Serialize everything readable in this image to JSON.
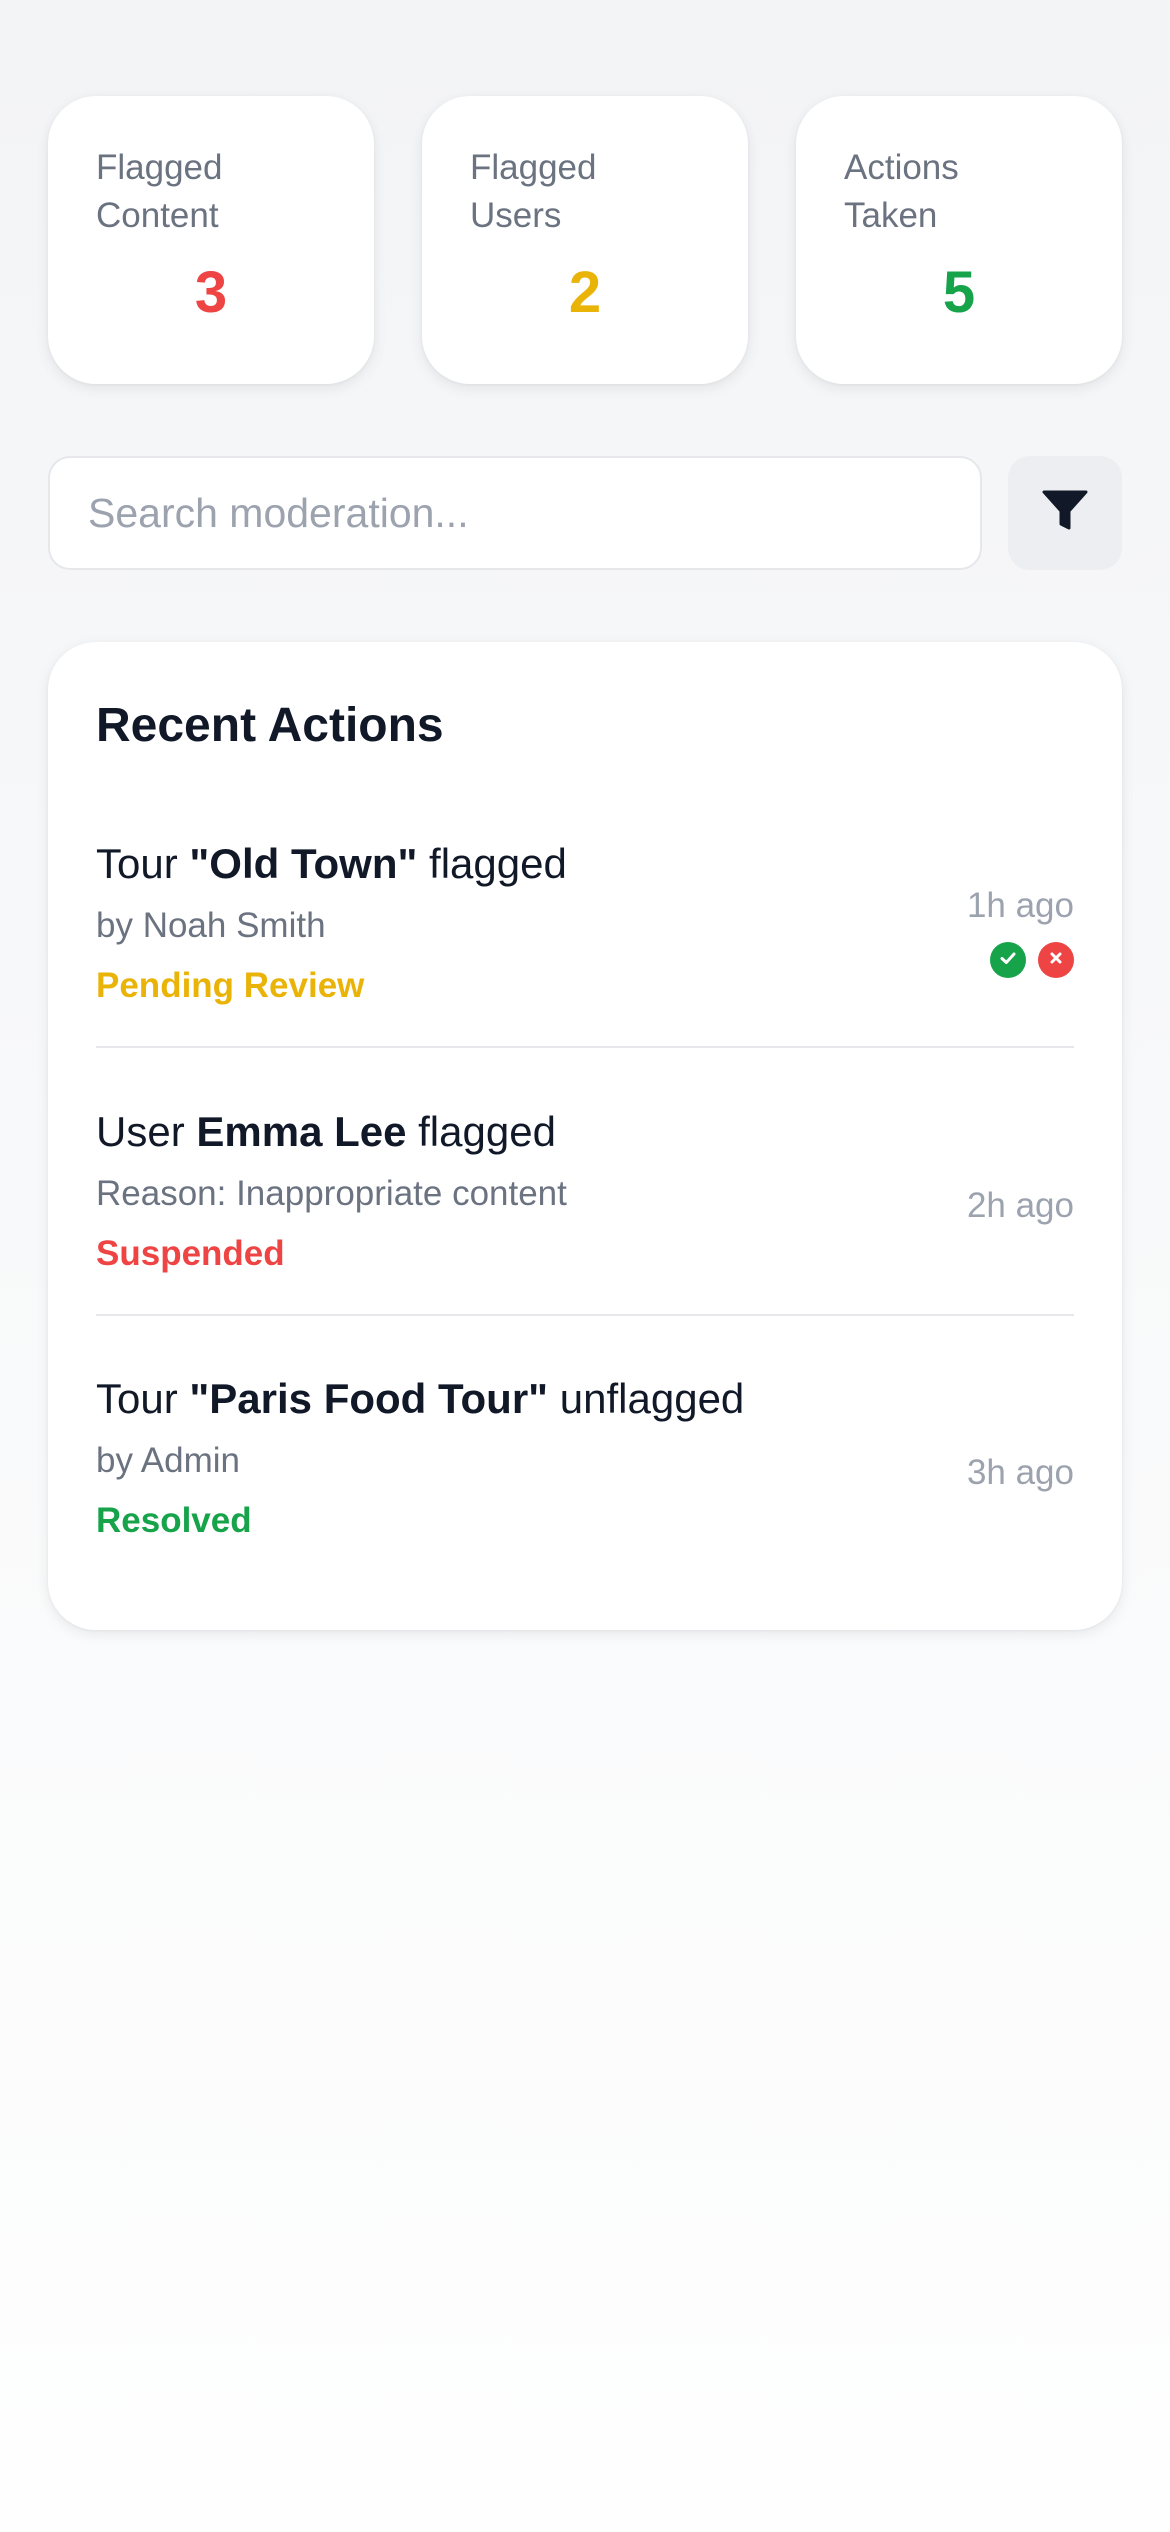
{
  "stats": [
    {
      "label_line1": "Flagged",
      "label_line2": "Content",
      "value": "3",
      "color": "#ef4444"
    },
    {
      "label_line1": "Flagged",
      "label_line2": "Users",
      "value": "2",
      "color": "#eab308"
    },
    {
      "label_line1": "Actions",
      "label_line2": "Taken",
      "value": "5",
      "color": "#16a34a"
    }
  ],
  "search": {
    "placeholder": "Search moderation...",
    "value": ""
  },
  "filter_icon": "filter-icon",
  "recent": {
    "title": "Recent Actions",
    "items": [
      {
        "prefix": "Tour ",
        "bold": "\"Old Town\"",
        "suffix": " flagged",
        "sub": "by Noah Smith",
        "status": "Pending Review",
        "status_color": "#eab308",
        "time": "1h ago",
        "approve_icon": "check-circle-icon",
        "reject_icon": "x-circle-icon"
      },
      {
        "prefix": "User ",
        "bold": "Emma Lee",
        "suffix": " flagged",
        "sub": "Reason: Inappropriate content",
        "status": "Suspended",
        "status_color": "#ef4444",
        "time": "2h ago"
      },
      {
        "prefix": "Tour ",
        "bold": "\"Paris Food Tour\"",
        "suffix": " unflagged",
        "sub": "by Admin",
        "status": "Resolved",
        "status_color": "#16a34a",
        "time": "3h ago"
      }
    ]
  },
  "colors": {
    "approve": "#16a34a",
    "reject": "#ef4444"
  }
}
